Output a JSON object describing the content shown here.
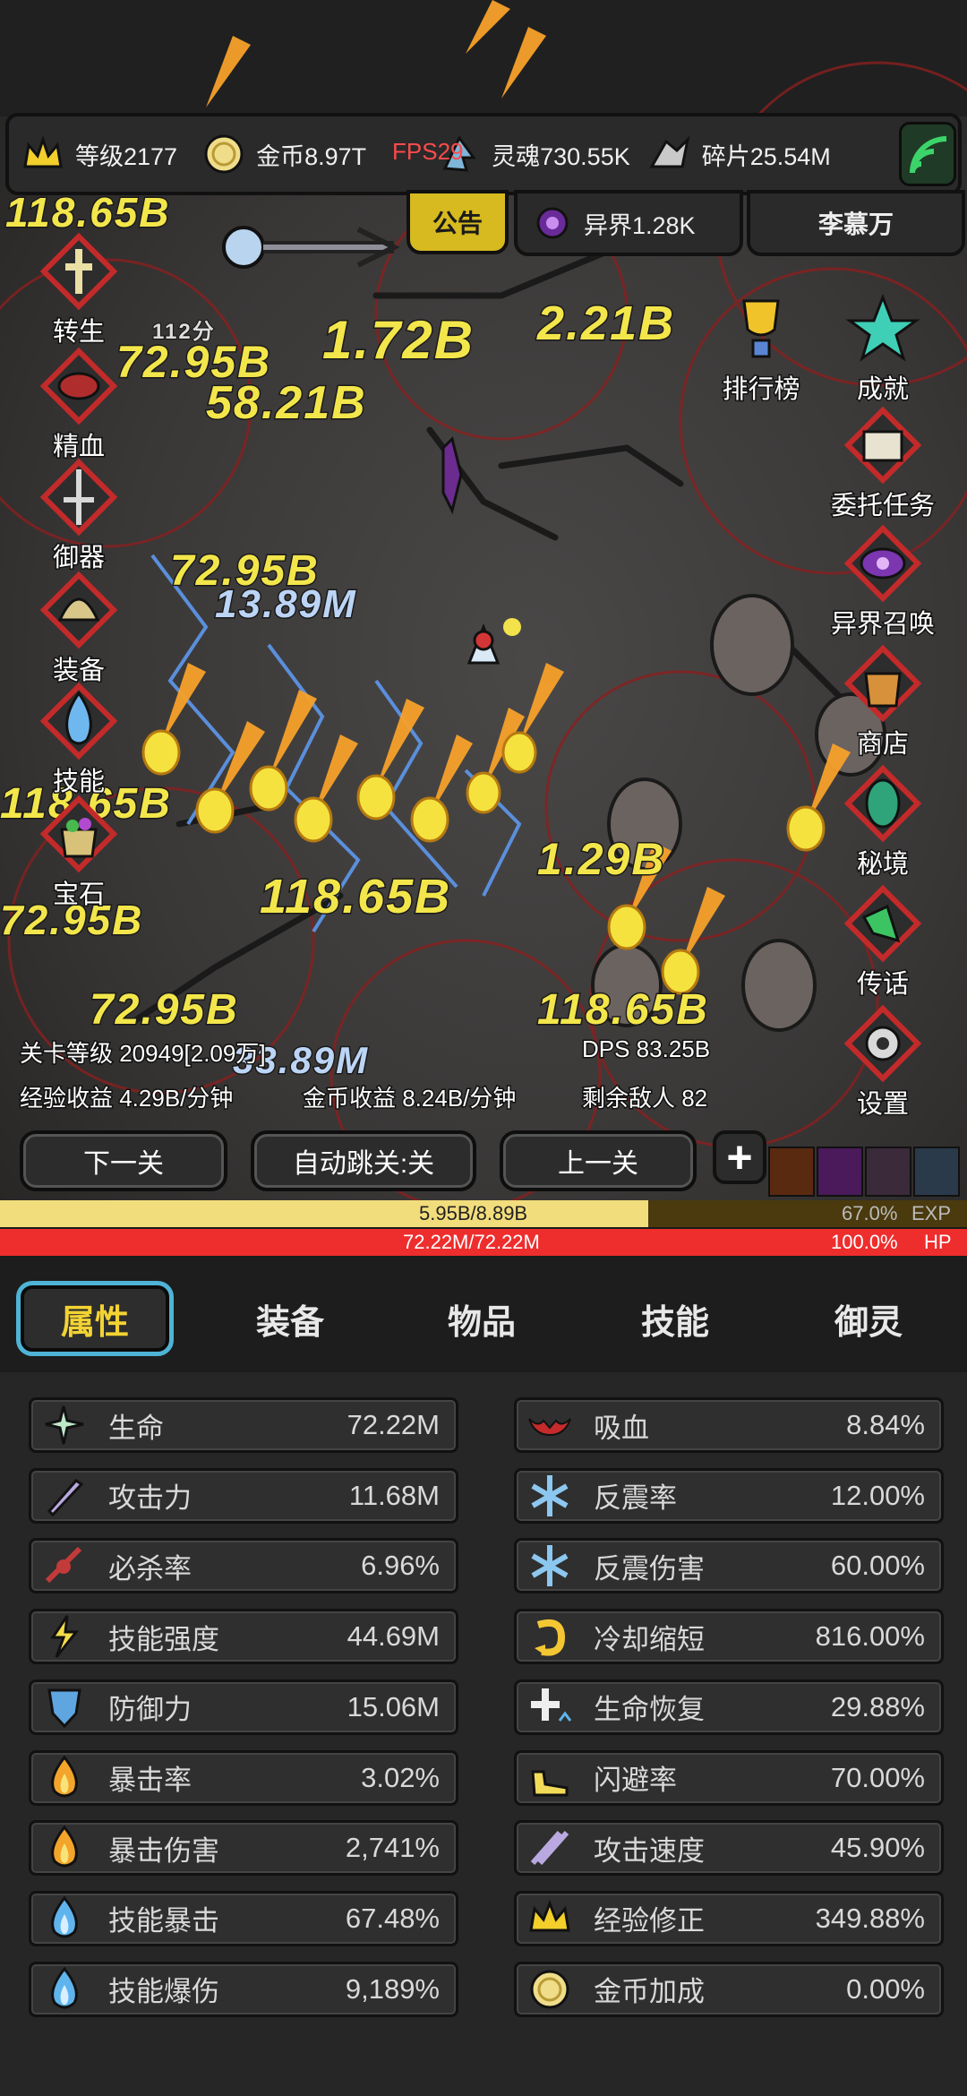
{
  "topbar": {
    "level": "等级2177",
    "gold": "金币8.97T",
    "fps": "FPS29",
    "soul": "灵魂730.55K",
    "shards": "碎片25.54M"
  },
  "subbar": {
    "notice": "公告",
    "otherworld": "异界1.28K",
    "player_name": "李慕万"
  },
  "left_menu": [
    "转生",
    "精血",
    "御器",
    "装备",
    "技能",
    "宝石"
  ],
  "right_menu": {
    "ranking": "排行榜",
    "achievement": "成就",
    "items": [
      "委托任务",
      "异界召唤",
      "商店",
      "秘境",
      "传话",
      "设置"
    ]
  },
  "timer": "112分",
  "damage_numbers": [
    "118.65B",
    "1.72B",
    "72.95B",
    "2.21B",
    "58.21B",
    "72.95B",
    "118.65B",
    "1.29B",
    "118.65B",
    "72.95B",
    "13.89M",
    "118.65B",
    "72.95B",
    "33.89M"
  ],
  "stage": {
    "level": "关卡等级 20949[2.09万]",
    "dps": "DPS 83.25B",
    "exp_income": "经验收益 4.29B/分钟",
    "gold_income": "金币收益 8.24B/分钟",
    "remaining": "剩余敌人 82"
  },
  "controls": {
    "next": "下一关",
    "auto": "自动跳关:关",
    "prev": "上一关",
    "plus": "+"
  },
  "exp": {
    "text": "5.95B/8.89B",
    "percent": "67.0%",
    "label": "EXP",
    "fill": 0.67
  },
  "hp": {
    "text": "72.22M/72.22M",
    "percent": "100.0%",
    "label": "HP",
    "fill": 1.0
  },
  "tabs": [
    "属性",
    "装备",
    "物品",
    "技能",
    "御灵"
  ],
  "stats_left": [
    {
      "name": "生命",
      "value": "72.22M",
      "icon": "life-icon"
    },
    {
      "name": "攻击力",
      "value": "11.68M",
      "icon": "sword-icon"
    },
    {
      "name": "必杀率",
      "value": "6.96%",
      "icon": "critical-kill-icon"
    },
    {
      "name": "技能强度",
      "value": "44.69M",
      "icon": "skill-power-icon"
    },
    {
      "name": "防御力",
      "value": "15.06M",
      "icon": "shield-icon"
    },
    {
      "name": "暴击率",
      "value": "3.02%",
      "icon": "fire-icon"
    },
    {
      "name": "暴击伤害",
      "value": "2,741%",
      "icon": "fire-icon"
    },
    {
      "name": "技能暴击",
      "value": "67.48%",
      "icon": "blue-fire-icon"
    },
    {
      "name": "技能爆伤",
      "value": "9,189%",
      "icon": "blue-fire-icon"
    }
  ],
  "stats_right": [
    {
      "name": "吸血",
      "value": "8.84%",
      "icon": "bat-icon"
    },
    {
      "name": "反震率",
      "value": "12.00%",
      "icon": "ice-icon"
    },
    {
      "name": "反震伤害",
      "value": "60.00%",
      "icon": "ice-icon"
    },
    {
      "name": "冷却缩短",
      "value": "816.00%",
      "icon": "cooldown-icon"
    },
    {
      "name": "生命恢复",
      "value": "29.88%",
      "icon": "regen-icon"
    },
    {
      "name": "闪避率",
      "value": "70.00%",
      "icon": "boot-icon"
    },
    {
      "name": "攻击速度",
      "value": "45.90%",
      "icon": "double-sword-icon"
    },
    {
      "name": "经验修正",
      "value": "349.88%",
      "icon": "crown-icon"
    },
    {
      "name": "金币加成",
      "value": "0.00%",
      "icon": "coin-icon"
    }
  ]
}
